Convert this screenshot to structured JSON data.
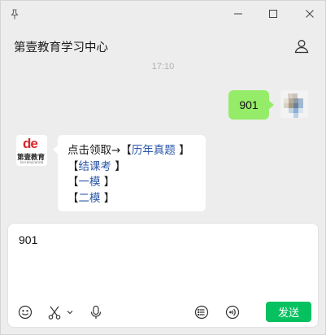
{
  "window": {
    "icons": [
      "pin-icon",
      "minimize-icon",
      "maximize-icon",
      "close-icon"
    ]
  },
  "header": {
    "title": "第壹教育学习中心",
    "contact_icon": "person-icon"
  },
  "chat": {
    "timestamp": "17:10",
    "messages": [
      {
        "sender": "me",
        "text": "901"
      },
      {
        "sender": "other",
        "avatar": {
          "logo_text": "de",
          "logo_cn": "第壹教育",
          "logo_en": "DIYI EDUCATION"
        },
        "lines": [
          {
            "prefix": "点击领取→【",
            "link": "历年真题",
            "suffix": " 】"
          },
          {
            "prefix": "【",
            "link": "结课考",
            "suffix": " 】"
          },
          {
            "prefix": "【",
            "link": "一模",
            "suffix": " 】"
          },
          {
            "prefix": "【",
            "link": "二模",
            "suffix": " 】"
          }
        ]
      }
    ]
  },
  "composer": {
    "value": "901",
    "tools": [
      "emoji-icon",
      "scissors-icon",
      "chevron-down-icon",
      "microphone-icon",
      "list-icon",
      "voice-call-icon"
    ],
    "send_label": "发送"
  },
  "colors": {
    "my_bubble": "#95ec69",
    "send_button": "#07c160",
    "link": "#2b57a8",
    "logo_red": "#d9262c"
  }
}
